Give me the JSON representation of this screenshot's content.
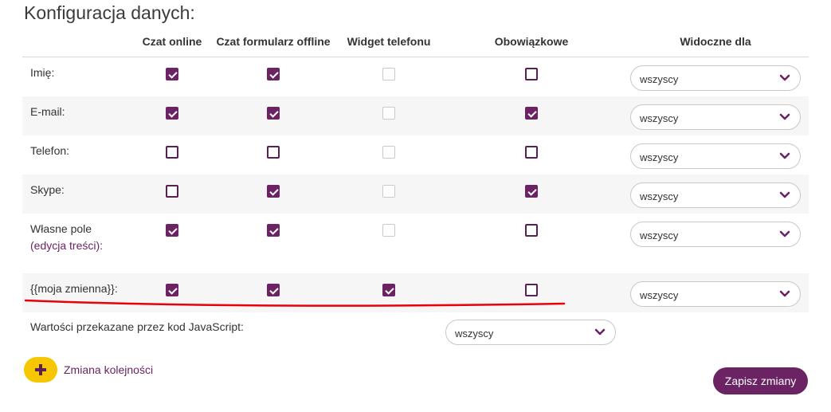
{
  "title": "Konfiguracja danych:",
  "headers": {
    "chat_online": "Czat online",
    "offline_form": "Czat formularz offline",
    "phone_widget": "Widget telefonu",
    "required": "Obowiązkowe",
    "visible_for": "Widoczne dla"
  },
  "rows": [
    {
      "label": "Imię:",
      "link": "",
      "chat_online": true,
      "offline_form": true,
      "phone_widget": false,
      "required": false,
      "visible_for": "wszyscy"
    },
    {
      "label": "E-mail:",
      "link": "",
      "chat_online": true,
      "offline_form": true,
      "phone_widget": false,
      "required": true,
      "visible_for": "wszyscy"
    },
    {
      "label": "Telefon:",
      "link": "",
      "chat_online": false,
      "offline_form": false,
      "phone_widget": false,
      "required": false,
      "visible_for": "wszyscy"
    },
    {
      "label": "Skype:",
      "link": "",
      "chat_online": false,
      "offline_form": true,
      "phone_widget": false,
      "required": true,
      "visible_for": "wszyscy"
    },
    {
      "label": "Własne pole",
      "link": "(edycja treści):",
      "chat_online": true,
      "offline_form": true,
      "phone_widget": false,
      "required": false,
      "visible_for": "wszyscy"
    },
    {
      "label": "{{moja zmienna}}:",
      "link": "",
      "chat_online": true,
      "offline_form": true,
      "phone_widget": true,
      "required": false,
      "visible_for": "wszyscy"
    }
  ],
  "js_values": {
    "label": "Wartości przekazane przez kod JavaScript:",
    "visible_for": "wszyscy"
  },
  "reorder_label": "Zmiana kolejności",
  "save_label": "Zapisz zmiany",
  "colors": {
    "accent": "#6b2363",
    "add_button": "#f6c700",
    "highlight_line": "#e8000b"
  },
  "icons": {
    "dropdown": "chevron-down-icon",
    "add": "plus-icon",
    "checked": "checkmark-icon"
  }
}
